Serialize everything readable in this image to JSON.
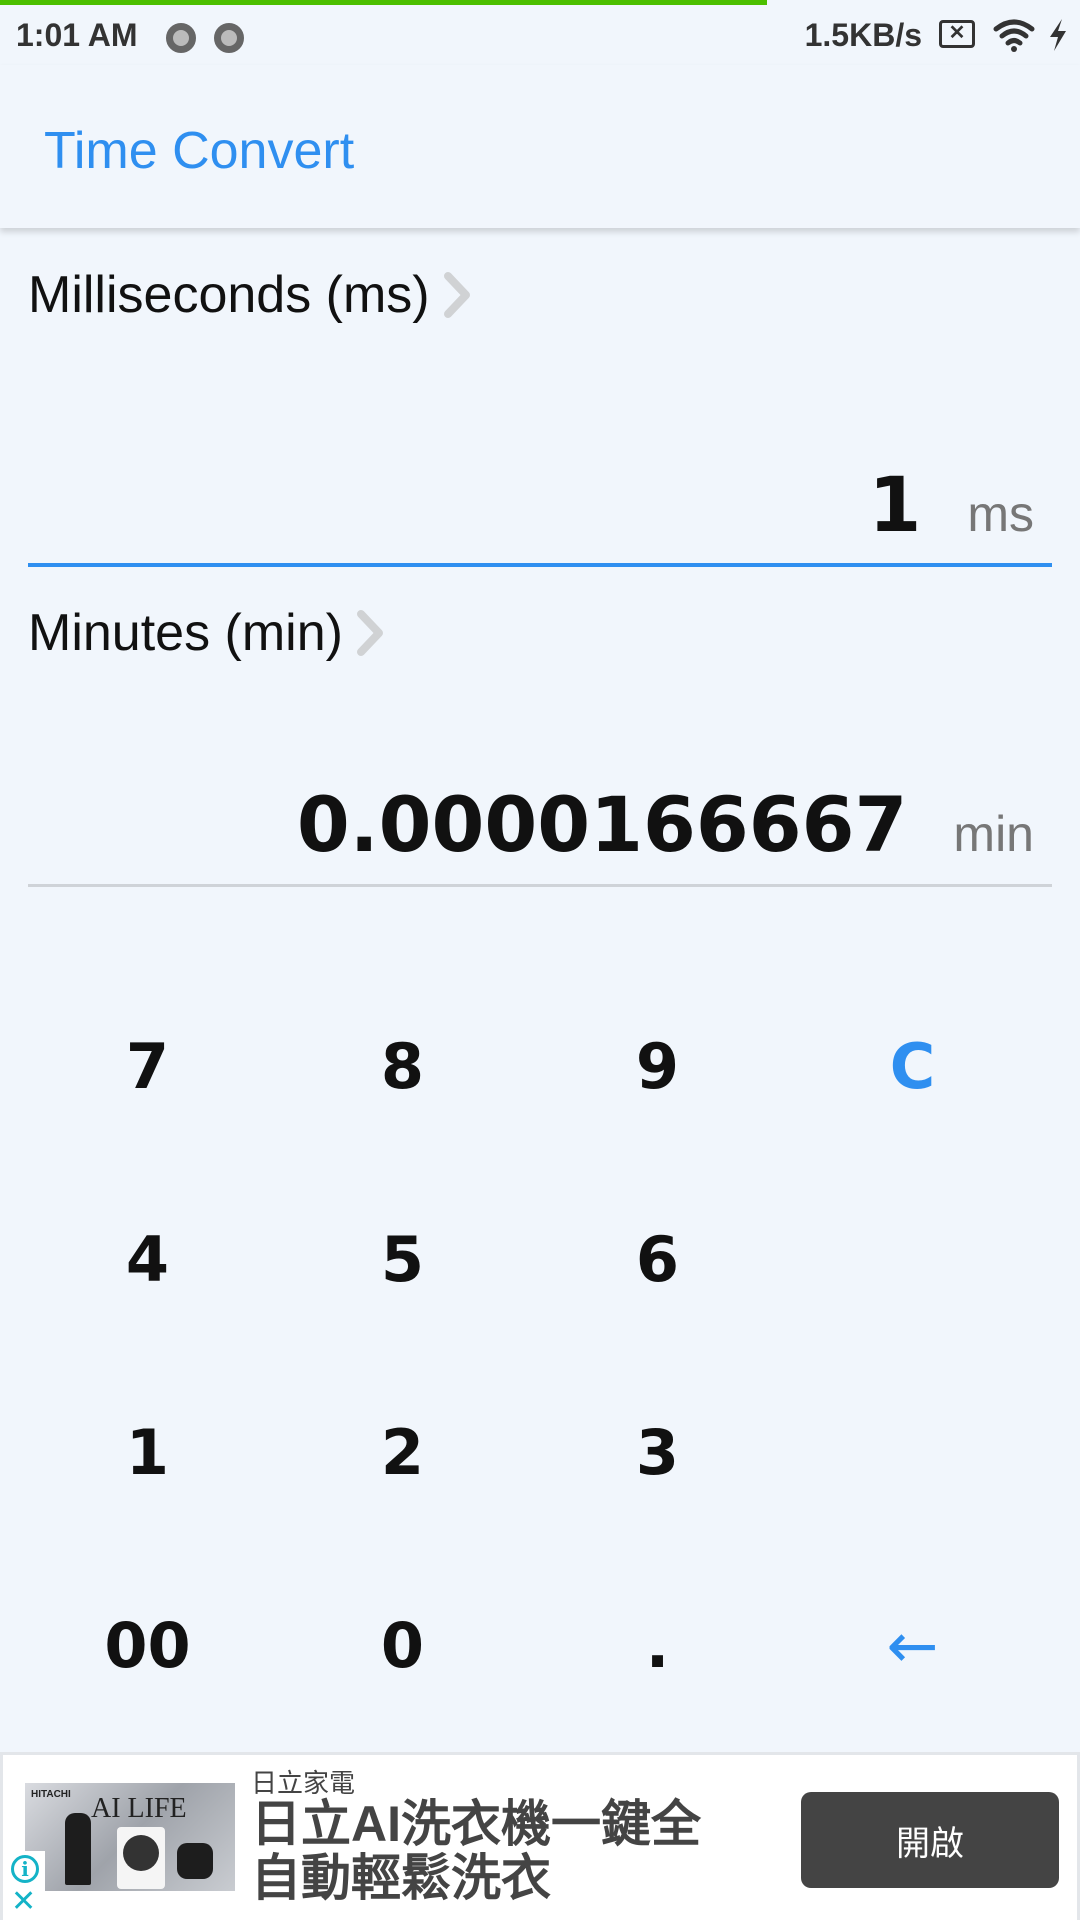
{
  "status_bar": {
    "time": "1:01 AM",
    "network_speed": "1.5KB/s",
    "icons": [
      "notification-dot-icon",
      "notification-dot-icon",
      "no-sim-icon",
      "wifi-icon",
      "charging-bolt-icon"
    ],
    "sim_glyph": "✕"
  },
  "page_load_progress": 0.71,
  "app_bar": {
    "title": "Time Convert"
  },
  "converter": {
    "from": {
      "unit_label": "Milliseconds (ms)",
      "value": "1",
      "unit_symbol": "ms"
    },
    "to": {
      "unit_label": "Minutes (min)",
      "value": "0.0000166667",
      "unit_symbol": "min"
    }
  },
  "keypad": {
    "keys": [
      {
        "label": "7",
        "type": "digit"
      },
      {
        "label": "8",
        "type": "digit"
      },
      {
        "label": "9",
        "type": "digit"
      },
      {
        "label": "C",
        "type": "clear"
      },
      {
        "label": "4",
        "type": "digit"
      },
      {
        "label": "5",
        "type": "digit"
      },
      {
        "label": "6",
        "type": "digit"
      },
      {
        "label": "",
        "type": "empty"
      },
      {
        "label": "1",
        "type": "digit"
      },
      {
        "label": "2",
        "type": "digit"
      },
      {
        "label": "3",
        "type": "digit"
      },
      {
        "label": "",
        "type": "empty"
      },
      {
        "label": "00",
        "type": "digit"
      },
      {
        "label": "0",
        "type": "digit"
      },
      {
        "label": ".",
        "type": "decimal"
      },
      {
        "label": "←",
        "type": "backspace"
      }
    ]
  },
  "ad": {
    "image_brand": "HITACHI",
    "image_title": "AI LIFE",
    "advertiser": "日立家電",
    "headline": "日立AI洗衣機一鍵全自動輕鬆洗衣",
    "cta_label": "開啟",
    "info_glyph": "i",
    "close_glyph": "✕"
  },
  "colors": {
    "accent": "#2f8ff0",
    "background": "#f1f6fc",
    "progress": "#4cbf00",
    "ad_cta": "#444444",
    "ad_icon": "#14b3c7"
  }
}
